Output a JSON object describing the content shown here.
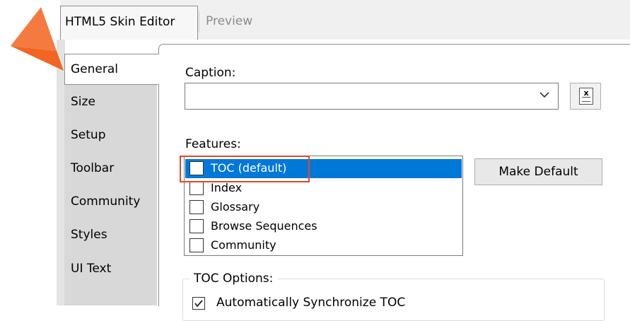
{
  "tabs": [
    {
      "label": "HTML5 Skin Editor",
      "active": true
    },
    {
      "label": "Preview",
      "active": false
    }
  ],
  "nav": {
    "items": [
      "General",
      "Size",
      "Setup",
      "Toolbar",
      "Community",
      "Styles",
      "UI Text"
    ],
    "selected": "General"
  },
  "caption": {
    "label": "Caption:",
    "value": "",
    "dropdown_icon": "chevron-down-icon",
    "button_icon": "excel-document-icon"
  },
  "features": {
    "label": "Features:",
    "items": [
      {
        "label": "TOC (default)",
        "checked": false,
        "selected": true
      },
      {
        "label": "Index",
        "checked": false,
        "selected": false
      },
      {
        "label": "Glossary",
        "checked": false,
        "selected": false
      },
      {
        "label": "Browse Sequences",
        "checked": false,
        "selected": false
      },
      {
        "label": "Community",
        "checked": false,
        "selected": false
      }
    ],
    "make_default_label": "Make Default"
  },
  "toc_options": {
    "title": "TOC Options:",
    "auto_sync_label": "Automatically Synchronize TOC",
    "auto_sync_checked": true
  },
  "colors": {
    "selection": "#0078d7",
    "highlight_box": "#e2472a",
    "pointer": "#f05a24"
  }
}
